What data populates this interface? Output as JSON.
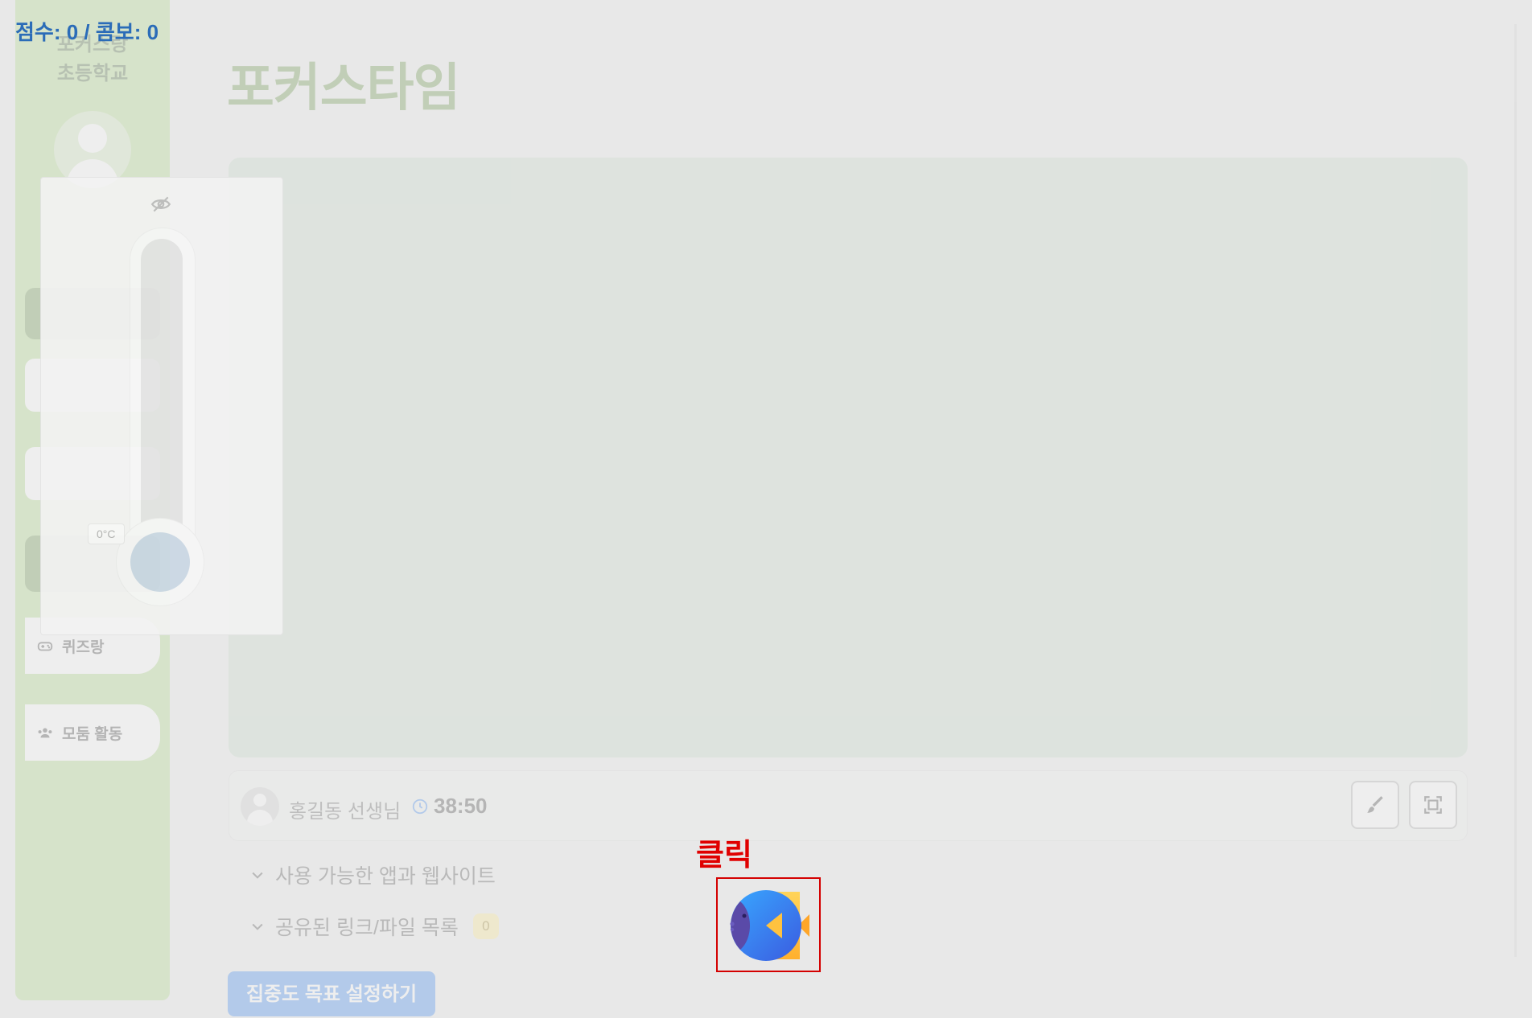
{
  "game": {
    "score_text": "점수: 0 / 콤보: 0",
    "click_hint": "클릭",
    "target_icon": "fish-icon"
  },
  "sidebar": {
    "school_line1": "포커스랑",
    "school_line2": "초등학교",
    "items": [
      {
        "label": "퀴즈랑",
        "icon": "game-controller-icon"
      },
      {
        "label": "모둠 활동",
        "icon": "group-icon"
      }
    ]
  },
  "main": {
    "title": "포커스타임",
    "teacher": "홍길동 선생님",
    "timer": "38:50",
    "apps_label": "사용 가능한 앱과 웹사이트",
    "links_label": "공유된 링크/파일 목록",
    "links_count": "0",
    "goal_button": "집중도 목표 설정하기"
  },
  "thermometer": {
    "temperature": "0°C",
    "level": 0
  },
  "colors": {
    "sidebar": "#a9d87f",
    "title": "#5e8d3a",
    "score": "#2b6cb8",
    "hint": "#e00000",
    "goal_button": "#2f7ff0"
  }
}
